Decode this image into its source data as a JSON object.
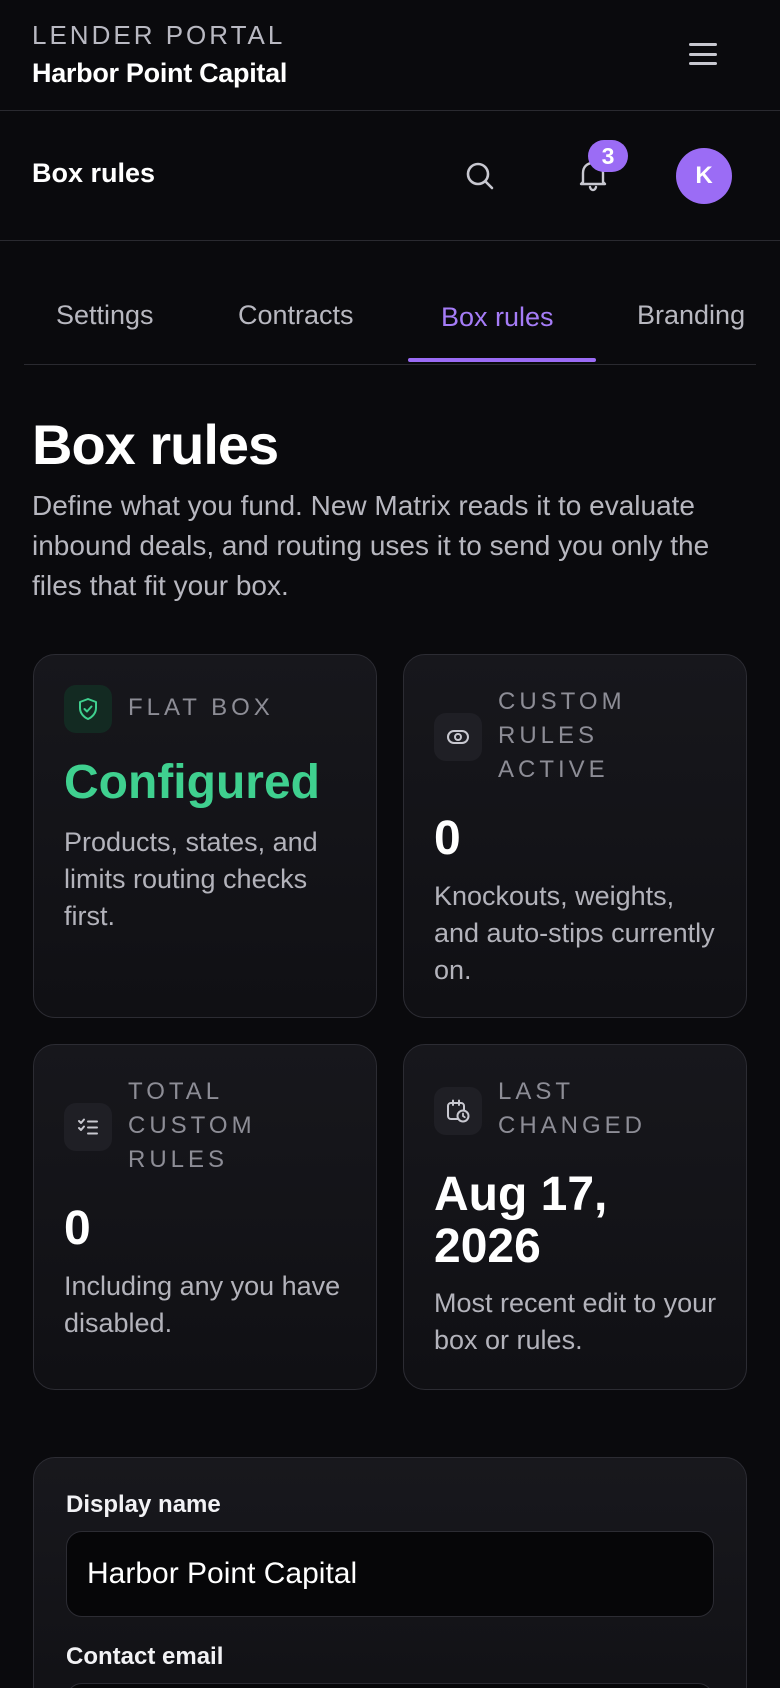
{
  "topbar": {
    "portal_label": "LENDER PORTAL",
    "brand_name": "Harbor Point Capital",
    "menu_icon": "hamburger-menu-icon"
  },
  "header": {
    "title": "Box rules",
    "search_icon": "search-icon",
    "bell_icon": "bell-icon",
    "notification_count": "3",
    "avatar_initial": "K"
  },
  "tabs": [
    {
      "label": "Settings",
      "active": false
    },
    {
      "label": "Contracts",
      "active": false
    },
    {
      "label": "Box rules",
      "active": true
    },
    {
      "label": "Branding",
      "active": false
    }
  ],
  "main": {
    "title": "Box rules",
    "description": "Define what you fund. New Matrix reads it to evaluate inbound deals, and routing uses it to send you only the files that fit your box."
  },
  "cards": {
    "flat_box": {
      "label": "FLAT BOX",
      "value": "Configured",
      "description": "Products, states, and limits routing checks first.",
      "icon": "shield-check-icon"
    },
    "custom_rules_active": {
      "label_lines": [
        "CUSTOM",
        "RULES",
        "ACTIVE"
      ],
      "value": "0",
      "description": "Knockouts, weights, and auto-stips currently on.",
      "icon": "eye-icon"
    },
    "total_custom_rules": {
      "label_lines": [
        "TOTAL",
        "CUSTOM",
        "RULES"
      ],
      "value": "0",
      "description": "Including any you have disabled.",
      "icon": "checklist-icon"
    },
    "last_changed": {
      "label_lines": [
        "LAST",
        "CHANGED"
      ],
      "value_lines": [
        "Aug 17,",
        "2026"
      ],
      "description": "Most recent edit to your box or rules.",
      "icon": "calendar-clock-icon"
    }
  },
  "form": {
    "display_name_label": "Display name",
    "display_name_value": "Harbor Point Capital",
    "contact_email_label": "Contact email"
  },
  "colors": {
    "background": "#0a0a0d",
    "accent": "#9b6cf5",
    "success": "#3fd08f"
  }
}
